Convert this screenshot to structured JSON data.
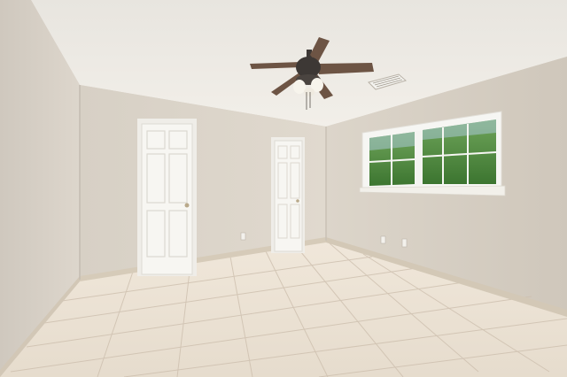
{
  "scene": {
    "kind": "photo",
    "subject": "empty-room-interior",
    "colors": {
      "ceiling": "#ece9e3",
      "wall_left": "#d8d1c7",
      "wall_back": "#ddd6cb",
      "wall_right": "#d6cfc4",
      "floor": "#ece2d4",
      "floor_grout": "#cbbfae",
      "baseboard": "#d6cbb9",
      "door": "#f6f4ef",
      "door_trim": "#f2f0ea",
      "window_frame": "#f7f7f5",
      "greenery": "#4f8c3c",
      "fan_blade": "#6d5444",
      "fan_body": "#3d3835"
    },
    "objects": [
      "ceiling-fan",
      "air-vent",
      "closet-door-left",
      "closet-door-right",
      "window",
      "electrical-outlet",
      "tile-floor"
    ]
  }
}
